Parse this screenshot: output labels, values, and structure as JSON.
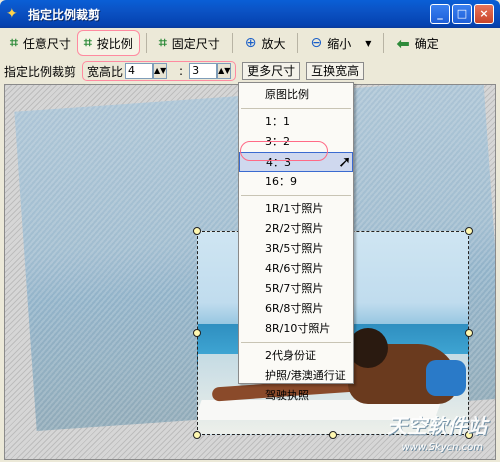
{
  "window": {
    "title": "指定比例裁剪",
    "min": "_",
    "max": "□",
    "close": "×"
  },
  "toolbar": {
    "free_size": "任意尺寸",
    "by_ratio": "按比例",
    "fixed_size": "固定尺寸",
    "zoom_in": "放大",
    "zoom_out": "缩小",
    "confirm": "确定"
  },
  "options": {
    "label": "指定比例裁剪",
    "ratio_label": "宽高比",
    "width": "4",
    "colon": ":",
    "height": "3",
    "more_sizes": "更多尺寸",
    "swap": "互换宽高"
  },
  "menu": {
    "items": [
      "原图比例",
      "1：1",
      "3：2",
      "4：3",
      "16：9",
      "1R/1寸照片",
      "2R/2寸照片",
      "3R/5寸照片",
      "4R/6寸照片",
      "5R/7寸照片",
      "6R/8寸照片",
      "8R/10寸照片",
      "2代身份证",
      "护照/港澳通行证",
      "驾驶执照"
    ],
    "selected": "4：3"
  },
  "watermark": {
    "brand": "天空软件站",
    "url": "www.Skycn.com"
  },
  "colors": {
    "accent": "#ff8aa0",
    "titlebar": "#0b52c4"
  }
}
